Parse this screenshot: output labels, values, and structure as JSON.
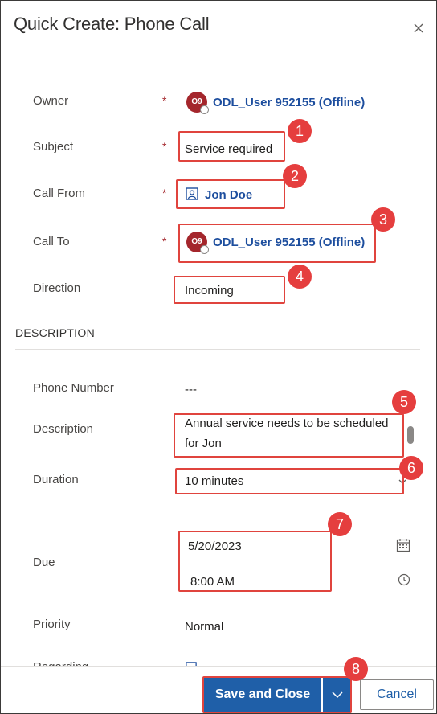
{
  "dialog": {
    "title": "Quick Create: Phone Call"
  },
  "fields": {
    "owner": {
      "label": "Owner",
      "required": "*",
      "avatar": "O9",
      "value": "ODL_User 952155 (Offline)"
    },
    "subject": {
      "label": "Subject",
      "required": "*",
      "value": "Service required"
    },
    "call_from": {
      "label": "Call From",
      "required": "*",
      "value": "Jon Doe"
    },
    "call_to": {
      "label": "Call To",
      "required": "*",
      "avatar": "O9",
      "value": "ODL_User 952155 (Offline)"
    },
    "direction": {
      "label": "Direction",
      "value": "Incoming"
    }
  },
  "description_section": {
    "title": "DESCRIPTION",
    "phone_number": {
      "label": "Phone Number",
      "value": "---"
    },
    "description": {
      "label": "Description",
      "value_line1": "Annual service needs to be scheduled",
      "value_line2": "for Jon"
    },
    "duration": {
      "label": "Duration",
      "value": "10 minutes"
    },
    "due": {
      "label": "Due",
      "date": "5/20/2023",
      "time": "8:00 AM"
    },
    "priority": {
      "label": "Priority",
      "value": "Normal"
    },
    "regarding": {
      "label": "Regarding"
    }
  },
  "footer": {
    "save_close_label": "Save and Close",
    "cancel_label": "Cancel"
  },
  "callouts": [
    "1",
    "2",
    "3",
    "4",
    "5",
    "6",
    "7",
    "8"
  ],
  "colors": {
    "accent": "#1f5fa8",
    "callout": "#e53e3e",
    "avatar": "#a4262c",
    "link": "#1d4e9e"
  },
  "icons": {
    "close": "close-icon",
    "contact": "contact-icon",
    "calendar": "calendar-icon",
    "clock": "clock-icon",
    "dropdown": "chevron-down-icon"
  }
}
